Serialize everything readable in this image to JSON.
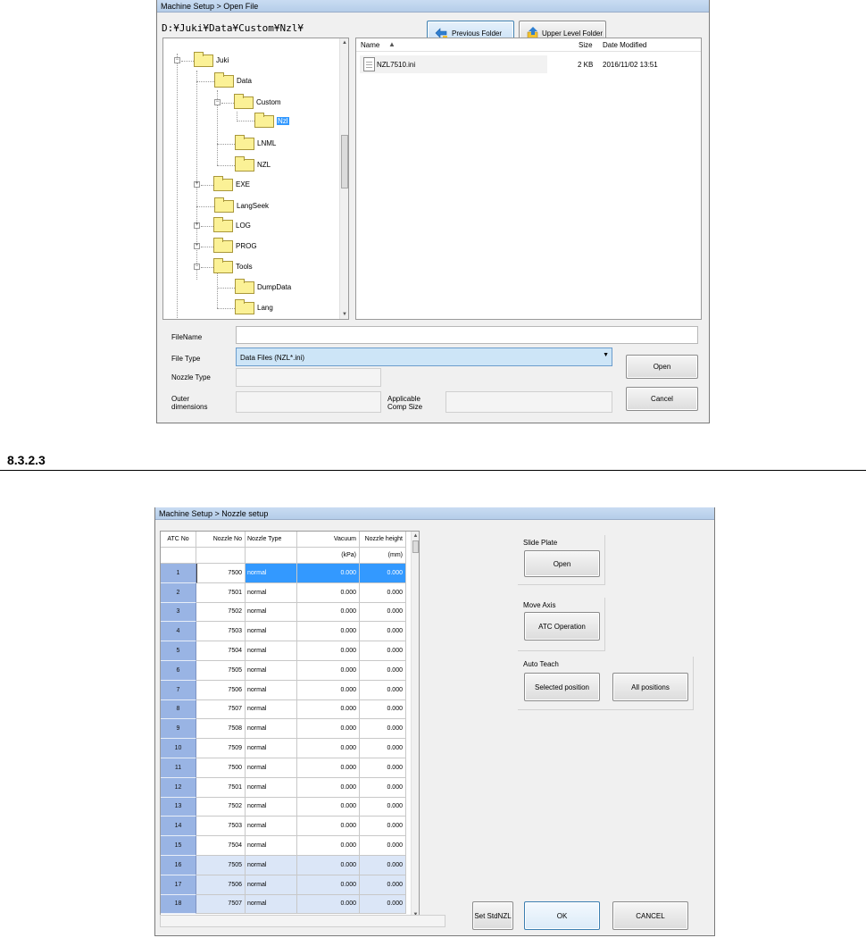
{
  "open_file": {
    "title": "Machine Setup > Open File",
    "path": "D:¥Juki¥Data¥Custom¥Nzl¥",
    "prev_folder_label": "Previous Folder",
    "upper_folder_label": "Upper Level Folder",
    "tree": [
      {
        "label": "Juki"
      },
      {
        "label": "Data"
      },
      {
        "label": "Custom"
      },
      {
        "label": "Nzl",
        "selected": true
      },
      {
        "label": "LNML"
      },
      {
        "label": "NZL"
      },
      {
        "label": "EXE"
      },
      {
        "label": "LangSeek"
      },
      {
        "label": "LOG"
      },
      {
        "label": "PROG"
      },
      {
        "label": "Tools"
      },
      {
        "label": "DumpData"
      },
      {
        "label": "Lang"
      }
    ],
    "list_headers": {
      "name": "Name",
      "size": "Size",
      "modified": "Date Modified"
    },
    "files": [
      {
        "name": "NZL7510.ini",
        "size": "2 KB",
        "modified": "2016/11/02 13:51"
      }
    ],
    "labels": {
      "filename": "FileName",
      "filetype": "File Type",
      "nozzle_type": "Nozzle Type",
      "outer_dim": "Outer dimensions",
      "applicable": "Applicable Comp Size"
    },
    "filename_value": "",
    "filetype_value": "Data Files (NZL*.ini)",
    "open_label": "Open",
    "cancel_label": "Cancel"
  },
  "section": {
    "heading": "8.3.2.3"
  },
  "nozzle_setup": {
    "title": "Machine Setup > Nozzle setup",
    "columns": [
      "ATC No",
      "Nozzle No",
      "Nozzle Type",
      "Vacuum",
      "Nozzle height"
    ],
    "units": [
      "",
      "",
      "",
      "(kPa)",
      "(mm)"
    ],
    "rows": [
      {
        "atc": "1",
        "nozzle": "7500",
        "type": "normal",
        "vacuum": "0.000",
        "height": "0.000"
      },
      {
        "atc": "2",
        "nozzle": "7501",
        "type": "normal",
        "vacuum": "0.000",
        "height": "0.000"
      },
      {
        "atc": "3",
        "nozzle": "7502",
        "type": "normal",
        "vacuum": "0.000",
        "height": "0.000"
      },
      {
        "atc": "4",
        "nozzle": "7503",
        "type": "normal",
        "vacuum": "0.000",
        "height": "0.000"
      },
      {
        "atc": "5",
        "nozzle": "7504",
        "type": "normal",
        "vacuum": "0.000",
        "height": "0.000"
      },
      {
        "atc": "6",
        "nozzle": "7505",
        "type": "normal",
        "vacuum": "0.000",
        "height": "0.000"
      },
      {
        "atc": "7",
        "nozzle": "7506",
        "type": "normal",
        "vacuum": "0.000",
        "height": "0.000"
      },
      {
        "atc": "8",
        "nozzle": "7507",
        "type": "normal",
        "vacuum": "0.000",
        "height": "0.000"
      },
      {
        "atc": "9",
        "nozzle": "7508",
        "type": "normal",
        "vacuum": "0.000",
        "height": "0.000"
      },
      {
        "atc": "10",
        "nozzle": "7509",
        "type": "normal",
        "vacuum": "0.000",
        "height": "0.000"
      },
      {
        "atc": "11",
        "nozzle": "7500",
        "type": "normal",
        "vacuum": "0.000",
        "height": "0.000"
      },
      {
        "atc": "12",
        "nozzle": "7501",
        "type": "normal",
        "vacuum": "0.000",
        "height": "0.000"
      },
      {
        "atc": "13",
        "nozzle": "7502",
        "type": "normal",
        "vacuum": "0.000",
        "height": "0.000"
      },
      {
        "atc": "14",
        "nozzle": "7503",
        "type": "normal",
        "vacuum": "0.000",
        "height": "0.000"
      },
      {
        "atc": "15",
        "nozzle": "7504",
        "type": "normal",
        "vacuum": "0.000",
        "height": "0.000"
      },
      {
        "atc": "16",
        "nozzle": "7505",
        "type": "normal",
        "vacuum": "0.000",
        "height": "0.000"
      },
      {
        "atc": "17",
        "nozzle": "7506",
        "type": "normal",
        "vacuum": "0.000",
        "height": "0.000"
      },
      {
        "atc": "18",
        "nozzle": "7507",
        "type": "normal",
        "vacuum": "0.000",
        "height": "0.000"
      }
    ],
    "slide_plate_label": "Slide Plate",
    "slide_open_label": "Open",
    "move_axis_label": "Move Axis",
    "atc_operation_label": "ATC Operation",
    "auto_teach_label": "Auto Teach",
    "selected_position_label": "Selected position",
    "all_positions_label": "All positions",
    "set_stdnzl_label": "Set StdNZL",
    "ok_label": "OK",
    "cancel_label": "CANCEL"
  },
  "colors": {
    "selected": "#3399ff",
    "row_header": "#99b4e4",
    "highlight_row": "#dbe6f7",
    "title_bar": "#c9dcf2"
  }
}
